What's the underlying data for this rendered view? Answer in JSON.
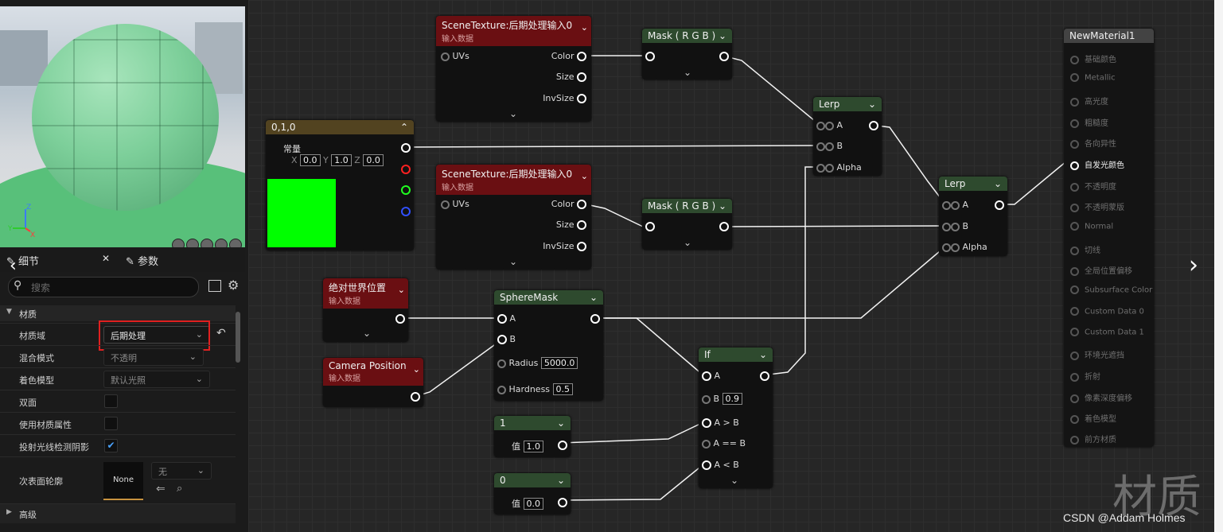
{
  "left": {
    "tabs": [
      {
        "label": "细节"
      },
      {
        "label": "参数"
      }
    ],
    "search_placeholder": "搜索",
    "category": "材质",
    "rows": [
      {
        "label": "材质域",
        "value": "后期处理"
      },
      {
        "label": "混合模式",
        "value": "不透明"
      },
      {
        "label": "着色模型",
        "value": "默认光照"
      },
      {
        "label": "双面"
      },
      {
        "label": "使用材质属性"
      },
      {
        "label": "投射光线检测阴影"
      },
      {
        "label": "次表面轮廓"
      }
    ],
    "subsurface_thumb": "None",
    "subsurface_dd": "无",
    "advanced": "高级"
  },
  "nodes": {
    "st1": {
      "title": "SceneTexture:后期处理输入0",
      "sub": "输入数据",
      "uvs": "UVs",
      "color": "Color",
      "size": "Size",
      "invsize": "InvSize"
    },
    "st2": {
      "title": "SceneTexture:后期处理输入0",
      "sub": "输入数据",
      "uvs": "UVs",
      "color": "Color",
      "size": "Size",
      "invsize": "InvSize"
    },
    "mask1": {
      "title": "Mask ( R G B )"
    },
    "mask2": {
      "title": "Mask ( R G B )"
    },
    "const3": {
      "title": "0,1,0",
      "label": "常量",
      "x": "X",
      "xv": "0.0",
      "y": "Y",
      "yv": "1.0",
      "z": "Z",
      "zv": "0.0"
    },
    "lerp1": {
      "title": "Lerp",
      "a": "A",
      "b": "B",
      "alpha": "Alpha"
    },
    "lerp2": {
      "title": "Lerp",
      "a": "A",
      "b": "B",
      "alpha": "Alpha"
    },
    "wpos": {
      "title": "绝对世界位置",
      "sub": "输入数据"
    },
    "campos": {
      "title": "Camera Position",
      "sub": "输入数据"
    },
    "sphere": {
      "title": "SphereMask",
      "a": "A",
      "b": "B",
      "radius": "Radius",
      "radius_v": "5000.0",
      "hardness": "Hardness",
      "hardness_v": "0.5"
    },
    "if": {
      "title": "If",
      "a": "A",
      "b": "B",
      "b_v": "0.9",
      "agb": "A > B",
      "aeb": "A == B",
      "alb": "A < B"
    },
    "c1": {
      "title": "1",
      "label": "值",
      "v": "1.0"
    },
    "c0": {
      "title": "0",
      "label": "值",
      "v": "0.0"
    },
    "material": {
      "title": "NewMaterial1",
      "pins": [
        "基础颜色",
        "Metallic",
        "高光度",
        "粗糙度",
        "各向异性",
        "自发光颜色",
        "不透明度",
        "不透明蒙版",
        "Normal",
        "切线",
        "全局位置偏移",
        "Subsurface Color",
        "Custom Data 0",
        "Custom Data 1",
        "环境光遮挡",
        "折射",
        "像素深度偏移",
        "着色模型",
        "前方材质"
      ]
    }
  },
  "watermark": "材质",
  "credit": "CSDN @Addam Holmes"
}
